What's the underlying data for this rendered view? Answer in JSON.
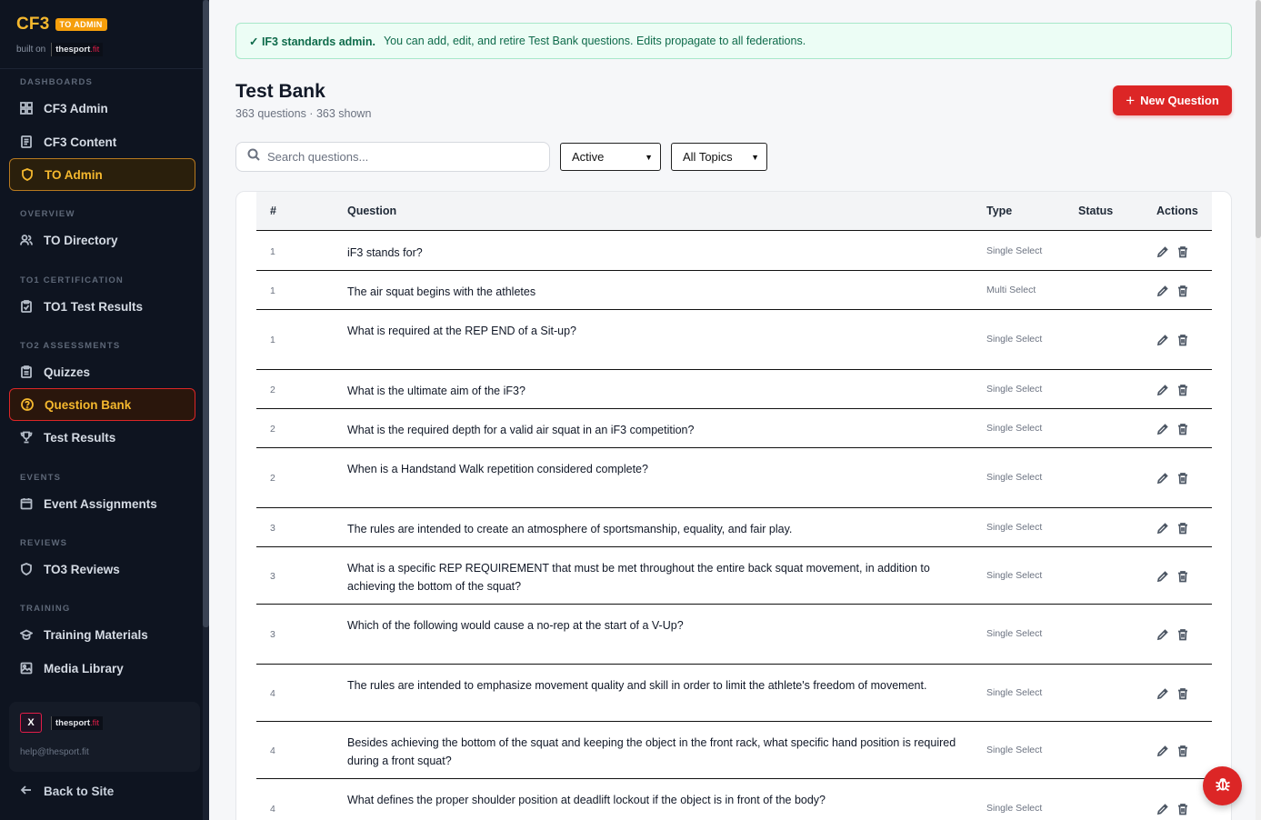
{
  "sidebar": {
    "brand": "CF3",
    "badge": "TO ADMIN",
    "built_on": "built on",
    "logo_text": "thesport",
    "logo_fit": ".fit",
    "sections": {
      "dashboards": "DASHBOARDS",
      "overview": "OVERVIEW",
      "to1": "TO1 CERTIFICATION",
      "to2": "TO2 ASSESSMENTS",
      "events": "EVENTS",
      "reviews": "REVIEWS",
      "training": "TRAINING"
    },
    "items": {
      "cf3_admin": "CF3 Admin",
      "cf3_content": "CF3 Content",
      "to_admin": "TO Admin",
      "to_directory": "TO Directory",
      "to1_results": "TO1 Test Results",
      "quizzes": "Quizzes",
      "question_bank": "Question Bank",
      "test_results": "Test Results",
      "event_assignments": "Event Assignments",
      "to3_reviews": "TO3 Reviews",
      "training_materials": "Training Materials",
      "media_library": "Media Library"
    },
    "footer": {
      "logo_mark": "X",
      "logo_text": "thesport",
      "logo_fit": ".fit",
      "email": "help@thesport.fit"
    },
    "back": "Back to Site"
  },
  "banner": {
    "strong": "✓ IF3 standards admin.",
    "text": "You can add, edit, and retire Test Bank questions. Edits propagate to all federations."
  },
  "page": {
    "title": "Test Bank",
    "subtitle": "363 questions · 363 shown",
    "new_button": "New Question"
  },
  "filters": {
    "search_placeholder": "Search questions...",
    "status": "Active",
    "topic": "All Topics"
  },
  "table": {
    "headers": {
      "num": "#",
      "question": "Question",
      "type": "Type",
      "status": "Status",
      "actions": "Actions"
    },
    "rows": [
      {
        "num": "1",
        "question": "iF3 stands for?",
        "type": "Single Select"
      },
      {
        "num": "1",
        "question": "The air squat begins with the athletes",
        "type": "Multi Select"
      },
      {
        "num": "1",
        "question": "What is required at the REP END of a Sit-up?",
        "type": "Single Select"
      },
      {
        "num": "2",
        "question": "What is the ultimate aim of the iF3?",
        "type": "Single Select"
      },
      {
        "num": "2",
        "question": "What is the required depth for a valid air squat in an iF3 competition?",
        "type": "Single Select"
      },
      {
        "num": "2",
        "question": "When is a Handstand Walk repetition considered complete?",
        "type": "Single Select"
      },
      {
        "num": "3",
        "question": "The rules are intended to create an atmosphere of sportsmanship, equality, and fair play.",
        "type": "Single Select"
      },
      {
        "num": "3",
        "question": "What is a specific REP REQUIREMENT that must be met throughout the entire back squat movement, in addition to achieving the bottom of the squat?",
        "type": "Single Select"
      },
      {
        "num": "3",
        "question": "Which of the following would cause a no-rep at the start of a V-Up?",
        "type": "Single Select"
      },
      {
        "num": "4",
        "question": "The rules are intended to emphasize movement quality and skill in order to limit the athlete's freedom of movement.",
        "type": "Single Select"
      },
      {
        "num": "4",
        "question": "Besides achieving the bottom of the squat and keeping the object in the front rack, what specific hand position is required during a front squat?",
        "type": "Single Select"
      },
      {
        "num": "4",
        "question": "What defines the proper shoulder position at deadlift lockout if the object is in front of the body?",
        "type": "Single Select"
      }
    ]
  }
}
